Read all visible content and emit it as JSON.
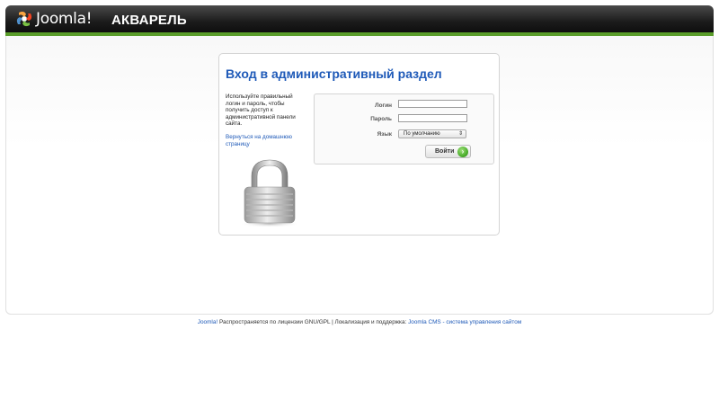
{
  "header": {
    "logo_text": "Joomla!",
    "site_name": "АКВАРЕЛЬ"
  },
  "login": {
    "title": "Вход в административный раздел",
    "help_text": "Используйте правильный логин и пароль, чтобы получить доступ к административной панели сайта.",
    "home_link": "Вернуться на домашнюю страницу",
    "username_label": "Логин",
    "username_value": "",
    "password_label": "Пароль",
    "password_value": "",
    "language_label": "Язык",
    "language_selected": "По умолчанию",
    "submit_label": "Войти"
  },
  "footer": {
    "joomla_link": "Joomla!",
    "license_text": " Распространяется по лицензии GNU/GPL | Локализация и поддержка: ",
    "cms_link": "Joomla CMS - система управления сайтом"
  },
  "colors": {
    "accent_blue": "#1f5ab8",
    "header_green": "#5a9d2a",
    "header_dark": "#1c1c1c"
  },
  "icons": {
    "logo": "joomla-logo-icon",
    "lock": "padlock-icon",
    "go": "arrow-right-circle-icon",
    "select_arrow": "updown-arrows-icon"
  }
}
